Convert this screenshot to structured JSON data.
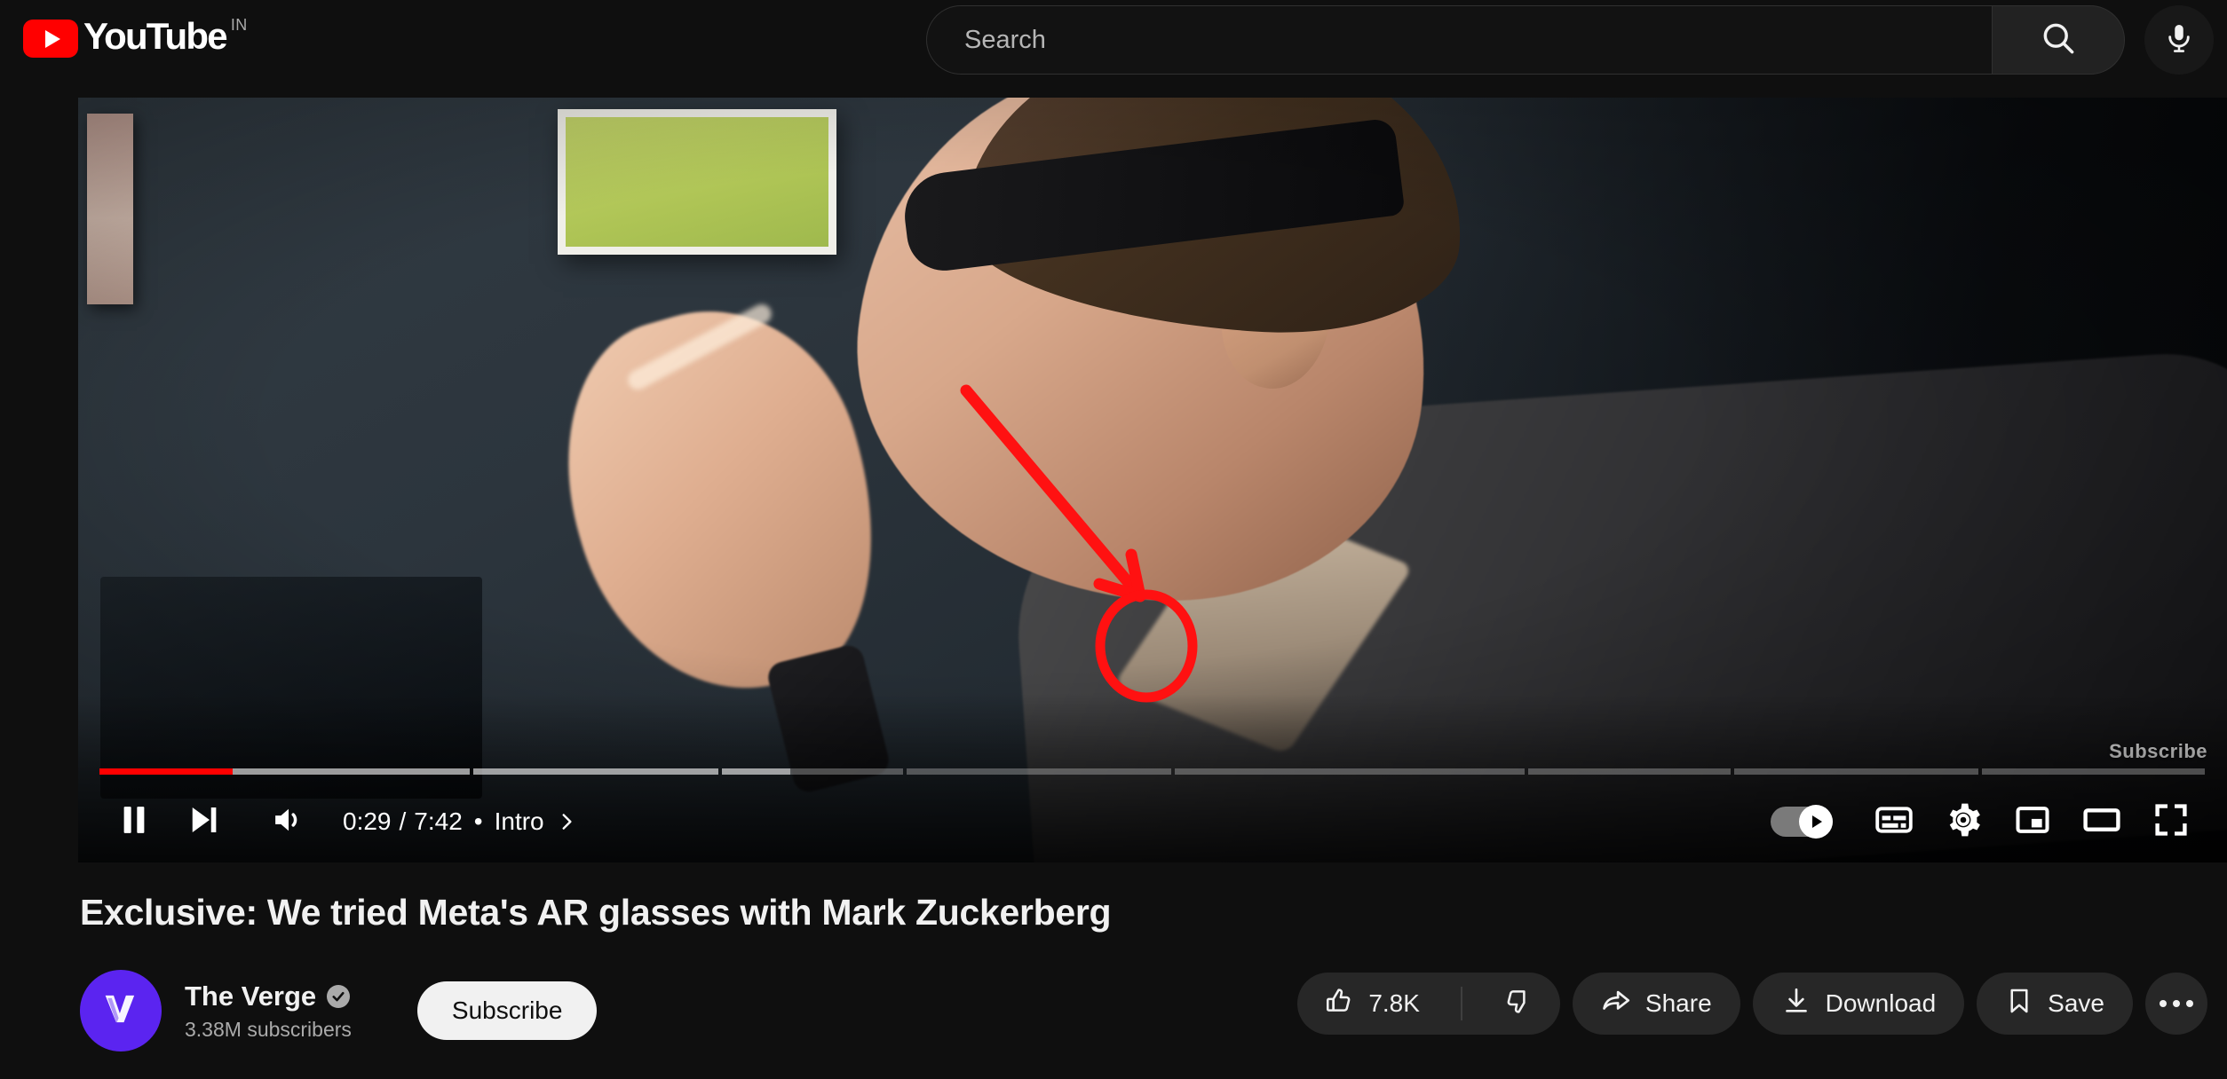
{
  "masthead": {
    "logo_text": "YouTube",
    "logo_icon": "youtube-play-icon",
    "country_code": "IN",
    "search": {
      "placeholder": "Search",
      "value": "",
      "search_icon": "search-icon",
      "mic_icon": "microphone-icon"
    }
  },
  "player": {
    "watermark": "Subscribe",
    "state": "playing",
    "current_time": "0:29",
    "duration": "7:42",
    "separator": "•",
    "chapter_label": "Intro",
    "chapter_chevron_icon": "chevron-right-icon",
    "controls_left": [
      {
        "name": "pause-button",
        "icon": "pause-icon",
        "label": "Pause"
      },
      {
        "name": "next-button",
        "icon": "next-track-icon",
        "label": "Next"
      },
      {
        "name": "volume-button",
        "icon": "volume-high-icon",
        "label": "Mute"
      }
    ],
    "controls_right": [
      {
        "name": "autoplay-toggle",
        "icon": "autoplay-toggle-icon",
        "label": "Autoplay",
        "state": "on"
      },
      {
        "name": "subtitles-button",
        "icon": "closed-captions-icon",
        "label": "Subtitles/closed captions"
      },
      {
        "name": "settings-button",
        "icon": "gear-icon",
        "label": "Settings",
        "highlighted": true
      },
      {
        "name": "miniplayer-button",
        "icon": "miniplayer-icon",
        "label": "Miniplayer"
      },
      {
        "name": "theater-button",
        "icon": "theater-mode-icon",
        "label": "Theater mode"
      },
      {
        "name": "fullscreen-button",
        "icon": "fullscreen-icon",
        "label": "Full screen"
      }
    ],
    "progress": {
      "played_percent": 6.3,
      "buffered_percent": 23,
      "chapters": [
        {
          "width_percent": 17.6,
          "played_percent": 36,
          "buffered_percent": 100
        },
        {
          "width_percent": 11.6,
          "played_percent": 0,
          "buffered_percent": 100
        },
        {
          "width_percent": 8.6,
          "played_percent": 0,
          "buffered_percent": 38
        },
        {
          "width_percent": 12.6,
          "played_percent": 0,
          "buffered_percent": 0
        },
        {
          "width_percent": 16.6,
          "played_percent": 0,
          "buffered_percent": 0
        },
        {
          "width_percent": 9.6,
          "played_percent": 0,
          "buffered_percent": 0
        },
        {
          "width_percent": 11.6,
          "played_percent": 0,
          "buffered_percent": 0
        },
        {
          "width_percent": 10.6,
          "played_percent": 0,
          "buffered_percent": 0
        }
      ]
    },
    "annotation": {
      "color": "#ff0000",
      "arrow": "red-arrow-pointing-to-settings",
      "circle": "red-circle-around-settings-button"
    }
  },
  "video": {
    "title": "Exclusive: We tried Meta's AR glasses with Mark Zuckerberg",
    "channel": {
      "name": "The Verge",
      "avatar_icon": "the-verge-logo",
      "verified_icon": "verified-check-icon",
      "subscribers": "3.38M subscribers",
      "subscribe_label": "Subscribe"
    },
    "actions": {
      "like_icon": "thumbs-up-icon",
      "like_count": "7.8K",
      "dislike_icon": "thumbs-down-icon",
      "share_icon": "share-arrow-icon",
      "share_label": "Share",
      "download_icon": "download-icon",
      "download_label": "Download",
      "save_icon": "bookmark-icon",
      "save_label": "Save",
      "more_icon": "more-horizontal-icon"
    }
  },
  "colors": {
    "brand_red": "#ff0000",
    "background": "#0f0f0f",
    "chip": "#272727",
    "text_primary": "#f1f1f1",
    "text_secondary": "#aaaaaa",
    "channel_accent": "#5b24f0"
  }
}
